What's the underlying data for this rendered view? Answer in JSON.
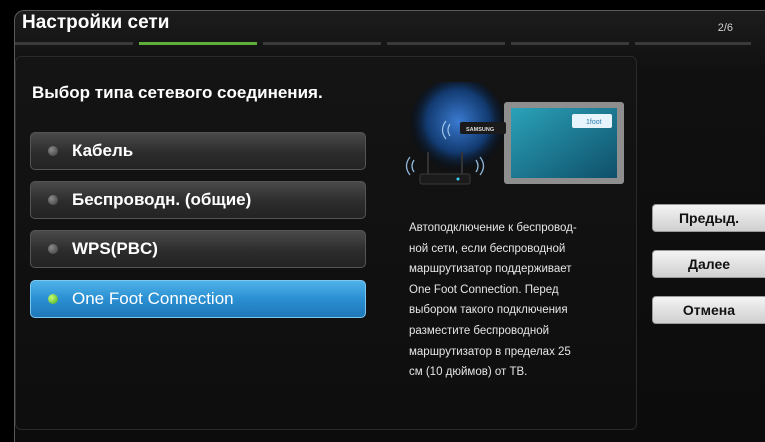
{
  "header": {
    "title": "Настройки сети",
    "page_indicator": "2/6"
  },
  "steps": {
    "total": 6,
    "current": 2
  },
  "main": {
    "question": "Выбор типа сетевого соединения.",
    "options": [
      {
        "label": "Кабель",
        "selected": false
      },
      {
        "label": "Беспроводн. (общие)",
        "selected": false
      },
      {
        "label": "WPS(PBC)",
        "selected": false
      },
      {
        "label": "One Foot Connection",
        "selected": true
      }
    ],
    "illustration": {
      "tv_brand": "SAMSUNG",
      "logo_text": "1foot"
    },
    "description_lines": [
      "Автоподключение к беспровод-",
      "ной сети, если беспроводной",
      "маршрутизатор поддерживает",
      "One Foot Connection. Перед",
      "выбором такого подключения",
      "разместите беспроводной",
      "маршрутизатор в пределах 25",
      "см (10 дюймов) от ТВ."
    ]
  },
  "buttons": {
    "prev": "Предыд.",
    "next": "Далее",
    "cancel": "Отмена"
  },
  "colors": {
    "accent_green": "#5fae3a",
    "selected_blue": "#2a8fd2"
  }
}
